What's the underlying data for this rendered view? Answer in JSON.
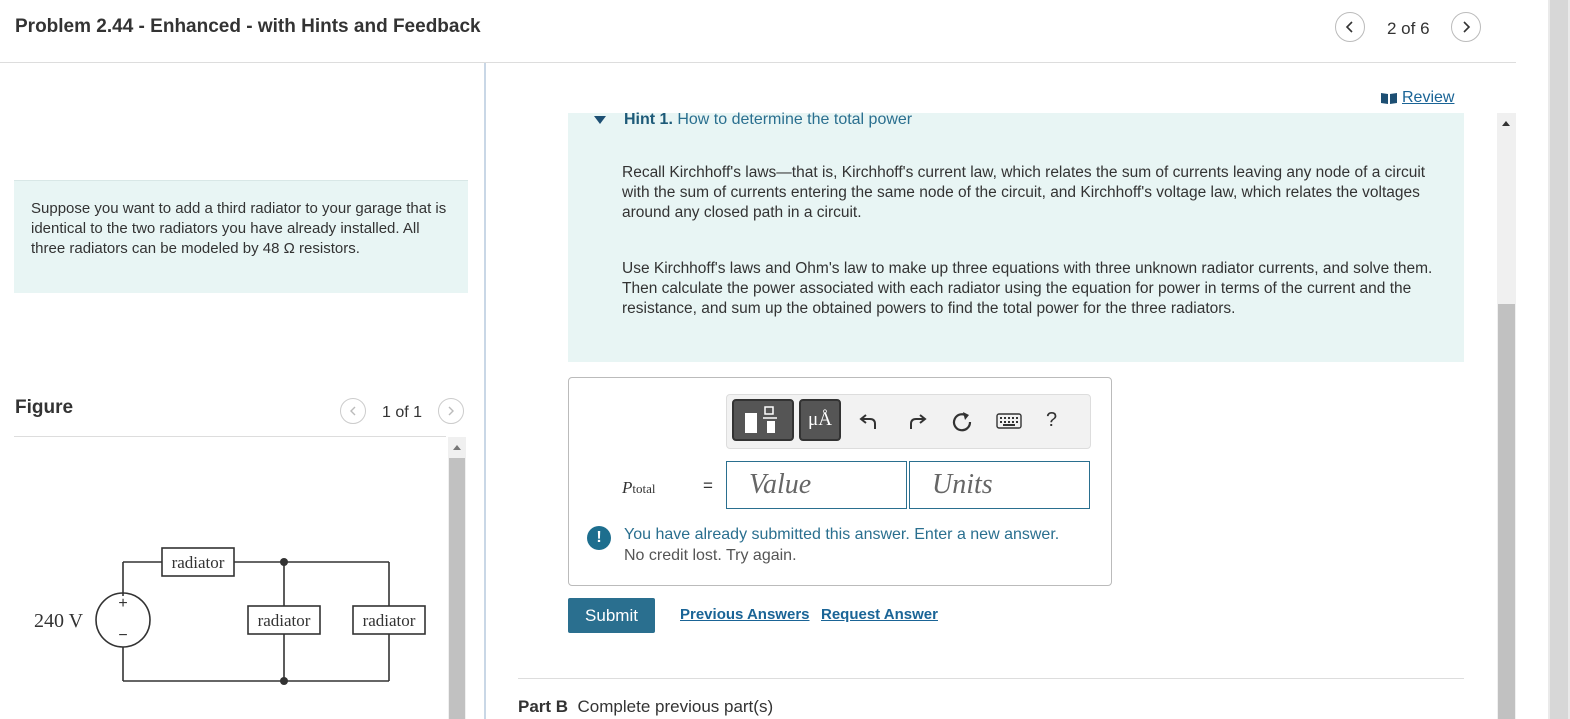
{
  "header": {
    "title": "Problem 2.44 - Enhanced - with Hints and Feedback",
    "pager": "2 of 6"
  },
  "problem": {
    "text": "Suppose you want to add a third radiator to your garage that is identical to the two radiators you have already installed. All three radiators can be modeled by 48 Ω resistors."
  },
  "figure": {
    "label": "Figure",
    "pager": "1 of 1",
    "source_label": "240 V",
    "radiator_label": "radiator",
    "plus": "+",
    "minus": "−"
  },
  "review": {
    "label": "Review"
  },
  "hint": {
    "number": "Hint 1.",
    "title": "How to determine the total power",
    "paragraphs": [
      "Recall Kirchhoff's laws—that is, Kirchhoff's current law, which relates the sum of currents leaving any node of a circuit with the sum of currents entering the same node of the circuit, and Kirchhoff's voltage law, which relates the voltages around any closed path in a circuit.",
      "Use Kirchhoff's laws and Ohm's law to make up three equations with three unknown radiator currents, and solve them. Then calculate the power associated with each radiator using the equation for power in terms of the current and the resistance, and sum up the obtained powers to find the total power for the three radiators."
    ]
  },
  "answer": {
    "variable": "P",
    "variable_sub": "total",
    "equals": "=",
    "value_placeholder": "Value",
    "units_placeholder": "Units",
    "toolbar": {
      "units_symbol": "μÅ",
      "help": "?"
    },
    "notice_icon": "!",
    "notice_line1": "You have already submitted this answer. Enter a new answer.",
    "notice_line2": "No credit lost. Try again."
  },
  "actions": {
    "submit": "Submit",
    "previous_answers": "Previous Answers",
    "request_answer": "Request Answer"
  },
  "part_b": {
    "label": "Part B",
    "status": "Complete previous part(s)"
  },
  "colors": {
    "accent": "#2a6f8f",
    "hint_bg": "#e8f5f4",
    "link": "#1a6496"
  }
}
